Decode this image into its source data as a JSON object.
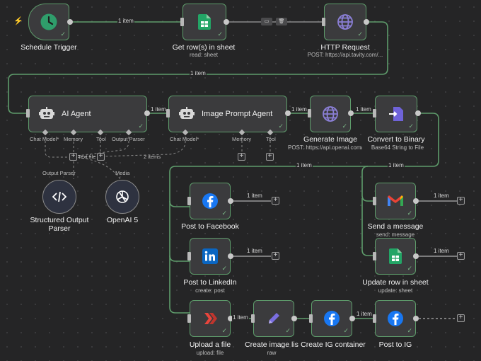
{
  "colors": {
    "edge": "#5e9c6b",
    "node_bg": "#3b3b3d",
    "canvas": "#252526"
  },
  "nodes": {
    "schedule": {
      "title": "Schedule Trigger",
      "icon": "clock-icon"
    },
    "getrows": {
      "title": "Get row(s) in sheet",
      "sub": "read: sheet",
      "icon": "google-sheets-icon"
    },
    "http": {
      "title": "HTTP Request",
      "sub": "POST: https://api.tavity.com/...",
      "icon": "globe-icon"
    },
    "aiagent": {
      "title": "AI Agent",
      "icon": "robot-icon"
    },
    "imgagent": {
      "title": "Image Prompt Agent",
      "icon": "robot-icon"
    },
    "genimage": {
      "title": "Generate Image",
      "sub": "POST: https://api.openai.com/...",
      "icon": "globe-icon"
    },
    "convert": {
      "title": "Convert to Binary",
      "sub": "Base64 String to File",
      "icon": "convert-icon"
    },
    "structured": {
      "title": "Structured Output Parser",
      "icon": "code-icon"
    },
    "openai": {
      "title": "OpenAI 5",
      "icon": "openai-icon"
    },
    "fb": {
      "title": "Post to Facebook",
      "icon": "facebook-icon"
    },
    "li": {
      "title": "Post to LinkedIn",
      "sub": "create: post",
      "icon": "linkedin-icon"
    },
    "upload": {
      "title": "Upload a file",
      "sub": "upload: file",
      "icon": "upload-icon"
    },
    "createimg": {
      "title": "Create image lis",
      "sub": "raw",
      "icon": "pen-icon"
    },
    "igcontainer": {
      "title": "Create IG container",
      "icon": "facebook-icon"
    },
    "postig": {
      "title": "Post to IG",
      "icon": "facebook-icon"
    },
    "gmail": {
      "title": "Send a message",
      "sub": "send: message",
      "icon": "gmail-icon"
    },
    "updaterow": {
      "title": "Update row in sheet",
      "sub": "update: sheet",
      "icon": "google-sheets-icon"
    }
  },
  "ports": {
    "ai": {
      "chat": "Chat Model*",
      "memory": "Memory",
      "tool": "Tool",
      "parser": "Output Parser"
    },
    "img": {
      "chat": "Chat Model*",
      "memory": "Memory",
      "tool": "Tool"
    }
  },
  "connector_labels": {
    "parser": "Output Parser",
    "media": "Media",
    "text": "Text file",
    "two_items": "2 items"
  },
  "counts": {
    "one": "1 item",
    "two": "2 items"
  }
}
